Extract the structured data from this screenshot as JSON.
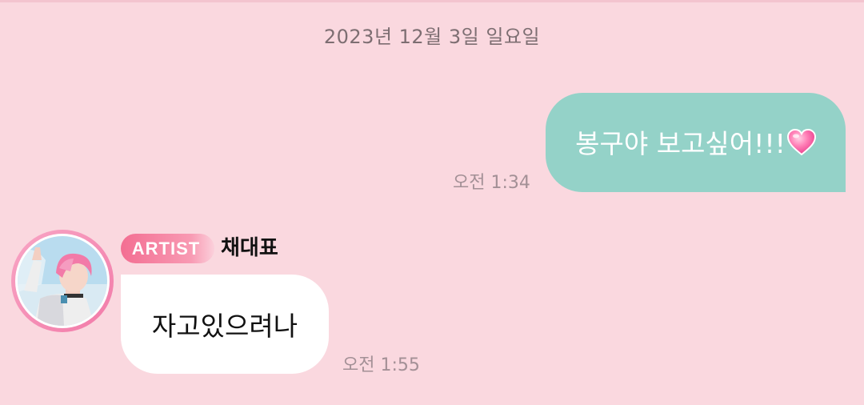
{
  "chat": {
    "date_separator": "2023년 12월 3일 일요일",
    "outgoing": {
      "text": "봉구야 보고싶어!!!",
      "emoji": "heart-icon",
      "time": "오전 1:34",
      "bubble_color": "#94d2c8"
    },
    "incoming": {
      "badge": "ARTIST",
      "sender": "채대표",
      "text": "자고있으려나",
      "time": "오전 1:55",
      "bubble_color": "#ffffff"
    }
  },
  "colors": {
    "background": "#fad8df",
    "badge_start": "#f36e92",
    "avatar_ring": "#f27aa8"
  }
}
